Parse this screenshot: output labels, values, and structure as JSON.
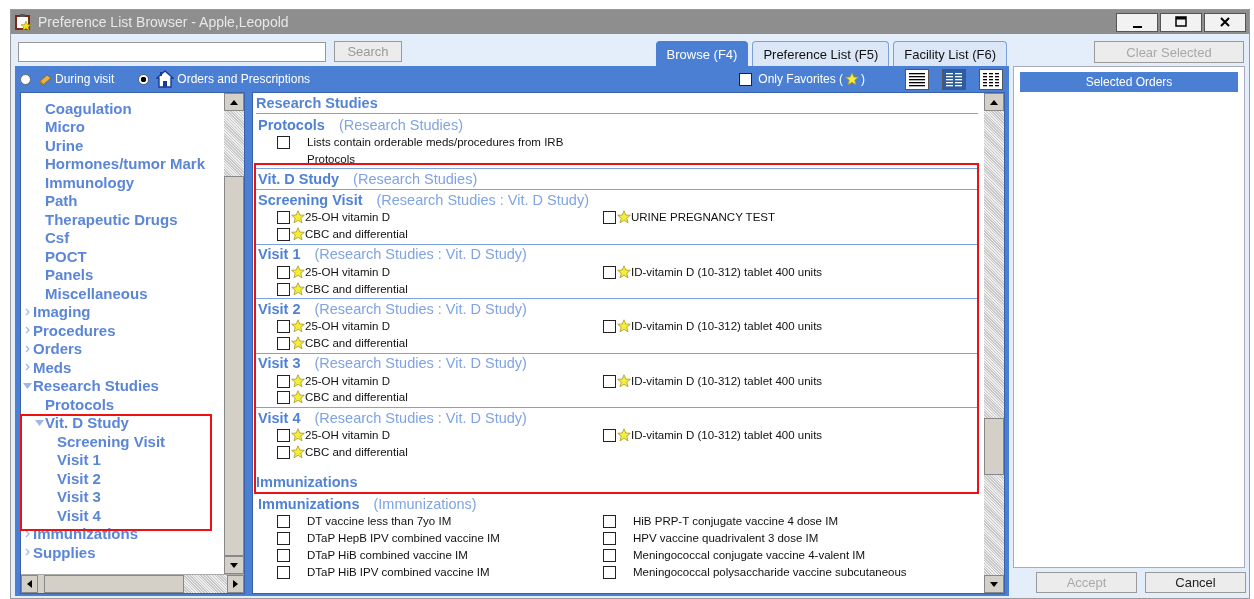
{
  "window": {
    "title": "Preference List Browser - Apple,Leopold"
  },
  "search": {
    "button": "Search"
  },
  "tabs": [
    {
      "label": "Browse (F4)",
      "selected": true
    },
    {
      "label": "Preference List (F5)",
      "selected": false
    },
    {
      "label": "Facility List (F6)",
      "selected": false
    }
  ],
  "modes": [
    {
      "kind": "visit",
      "label": "During visit",
      "selected": false
    },
    {
      "kind": "orders",
      "label": "Orders and Prescriptions",
      "selected": true
    }
  ],
  "only_favorites": {
    "label": "Only Favorites (",
    "suffix": ")",
    "checked": false
  },
  "view_modes": [
    {
      "kind": "list",
      "selected": false
    },
    {
      "kind": "columns",
      "selected": true
    },
    {
      "kind": "grid",
      "selected": false
    }
  ],
  "tree": {
    "items": [
      {
        "children": [
          {
            "label": "Coagulation"
          },
          {
            "label": "Micro"
          },
          {
            "label": "Urine"
          },
          {
            "label": "Hormones/tumor Mark"
          },
          {
            "label": "Immunology"
          },
          {
            "label": "Path"
          },
          {
            "label": "Therapeutic Drugs"
          },
          {
            "label": "Csf"
          },
          {
            "label": "POCT"
          },
          {
            "label": "Panels"
          },
          {
            "label": "Miscellaneous"
          }
        ]
      },
      {
        "label": "Imaging",
        "expanded": false
      },
      {
        "label": "Procedures",
        "expanded": false
      },
      {
        "label": "Orders",
        "expanded": false
      },
      {
        "label": "Meds",
        "expanded": false
      },
      {
        "label": "Research Studies",
        "expanded": true,
        "children": [
          {
            "label": "Protocols"
          },
          {
            "label": "Vit. D Study",
            "expanded": true,
            "children": [
              {
                "label": "Screening Visit"
              },
              {
                "label": "Visit 1"
              },
              {
                "label": "Visit 2"
              },
              {
                "label": "Visit 3"
              },
              {
                "label": "Visit 4"
              }
            ]
          }
        ]
      },
      {
        "label": "Immunizations",
        "expanded": false
      },
      {
        "label": "Supplies",
        "expanded": false
      }
    ]
  },
  "browse_list": {
    "sections": [
      {
        "kind": "category",
        "title": "Research Studies"
      },
      {
        "kind": "group",
        "title": "Protocols",
        "path": "(Research Studies)",
        "columns": [
          [
            {
              "label": "Lists contain orderable meds/procedures from IRB Protocols",
              "checked": false,
              "favorite": false
            }
          ]
        ]
      },
      {
        "kind": "group",
        "title": "Vit. D Study",
        "path": "(Research Studies)"
      },
      {
        "kind": "group",
        "title": "Screening Visit",
        "path": "(Research Studies : Vit. D Study)",
        "columns": [
          [
            {
              "label": "25-OH vitamin D",
              "checked": false,
              "favorite": true
            },
            {
              "label": "CBC and differential",
              "checked": false,
              "favorite": true
            }
          ],
          [
            {
              "label": "URINE PREGNANCY TEST",
              "checked": false,
              "favorite": true
            }
          ]
        ]
      },
      {
        "kind": "group",
        "title": "Visit 1",
        "path": "(Research Studies : Vit. D Study)",
        "columns": [
          [
            {
              "label": "25-OH vitamin D",
              "checked": false,
              "favorite": true
            },
            {
              "label": "CBC and differential",
              "checked": false,
              "favorite": true
            }
          ],
          [
            {
              "label": "ID-vitamin D (10-312) tablet 400 units",
              "checked": false,
              "favorite": true
            }
          ]
        ]
      },
      {
        "kind": "group",
        "title": "Visit 2",
        "path": "(Research Studies : Vit. D Study)",
        "columns": [
          [
            {
              "label": "25-OH vitamin D",
              "checked": false,
              "favorite": true
            },
            {
              "label": "CBC and differential",
              "checked": false,
              "favorite": true
            }
          ],
          [
            {
              "label": "ID-vitamin D (10-312) tablet 400 units",
              "checked": false,
              "favorite": true
            }
          ]
        ]
      },
      {
        "kind": "group",
        "title": "Visit 3",
        "path": "(Research Studies : Vit. D Study)",
        "columns": [
          [
            {
              "label": "25-OH vitamin D",
              "checked": false,
              "favorite": true
            },
            {
              "label": "CBC and differential",
              "checked": false,
              "favorite": true
            }
          ],
          [
            {
              "label": "ID-vitamin D (10-312) tablet 400 units",
              "checked": false,
              "favorite": true
            }
          ]
        ]
      },
      {
        "kind": "group",
        "title": "Visit 4",
        "path": "(Research Studies : Vit. D Study)",
        "columns": [
          [
            {
              "label": "25-OH vitamin D",
              "checked": false,
              "favorite": true
            },
            {
              "label": "CBC and differential",
              "checked": false,
              "favorite": true
            }
          ],
          [
            {
              "label": "ID-vitamin D (10-312) tablet 400 units",
              "checked": false,
              "favorite": true
            }
          ]
        ]
      },
      {
        "kind": "category",
        "title": "Immunizations"
      },
      {
        "kind": "group",
        "title": "Immunizations",
        "path": "(Immunizations)",
        "columns": [
          [
            {
              "label": "DT vaccine less than 7yo IM",
              "checked": false,
              "favorite": false
            },
            {
              "label": "DTaP HepB IPV combined vaccine IM",
              "checked": false,
              "favorite": false
            },
            {
              "label": "DTaP HiB combined vaccine IM",
              "checked": false,
              "favorite": false
            },
            {
              "label": "DTaP HiB IPV combined vaccine IM",
              "checked": false,
              "favorite": false
            }
          ],
          [
            {
              "label": "HiB PRP-T conjugate vaccine 4 dose IM",
              "checked": false,
              "favorite": false
            },
            {
              "label": "HPV vaccine quadrivalent 3 dose IM",
              "checked": false,
              "favorite": false
            },
            {
              "label": "Meningococcal conjugate vaccine 4-valent IM",
              "checked": false,
              "favorite": false
            },
            {
              "label": "Meningococcal polysaccharide vaccine subcutaneous",
              "checked": false,
              "favorite": false
            }
          ]
        ]
      }
    ]
  },
  "clear_button": {
    "label": "Clear Selected",
    "disabled": true
  },
  "selected_orders": {
    "title": "Selected Orders"
  },
  "buttons": [
    {
      "label": "Accept",
      "disabled": true
    },
    {
      "label": "Cancel",
      "disabled": false
    }
  ]
}
